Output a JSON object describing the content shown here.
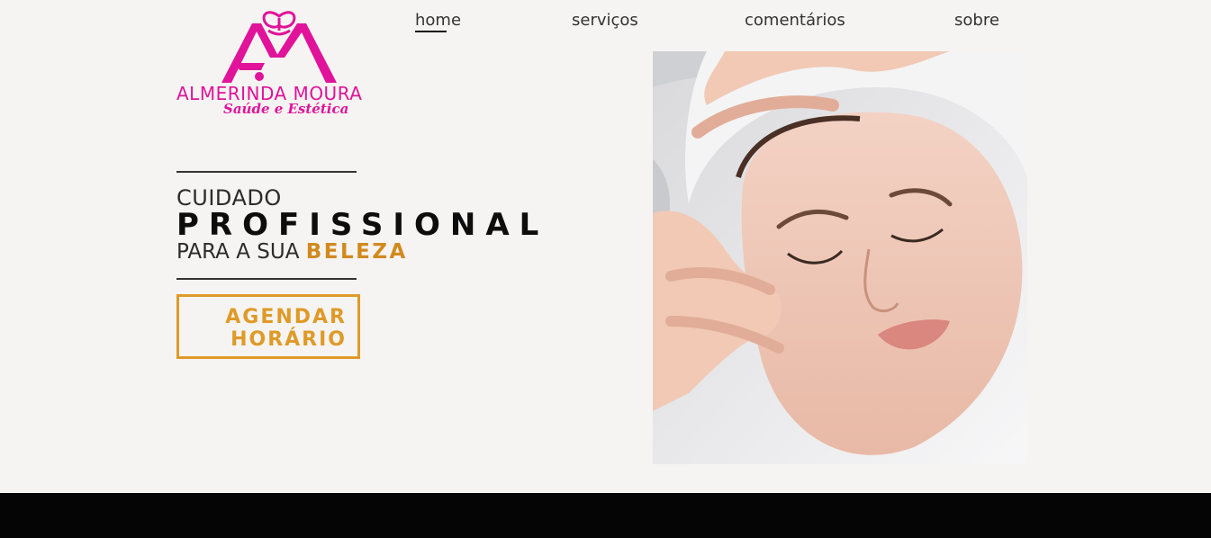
{
  "brand": {
    "name": "ALMERINDA MOURA",
    "tagline": "Saúde e Estética",
    "color": "#e0139a"
  },
  "nav": {
    "items": [
      {
        "label": "home",
        "active": true
      },
      {
        "label": "serviços",
        "active": false
      },
      {
        "label": "comentários",
        "active": false
      },
      {
        "label": "sobre",
        "active": false
      }
    ]
  },
  "hero": {
    "line1": "CUIDADO",
    "line2": "PROFISSIONAL",
    "line3_prefix": "PARA A SUA ",
    "line3_accent": "BELEZA",
    "accent_color": "#d18a1e",
    "cta_line1": "AGENDAR",
    "cta_line2": "HORÁRIO"
  },
  "photo": {
    "icon": "facial-massage-photo"
  },
  "footer": {
    "color": "#050505"
  }
}
